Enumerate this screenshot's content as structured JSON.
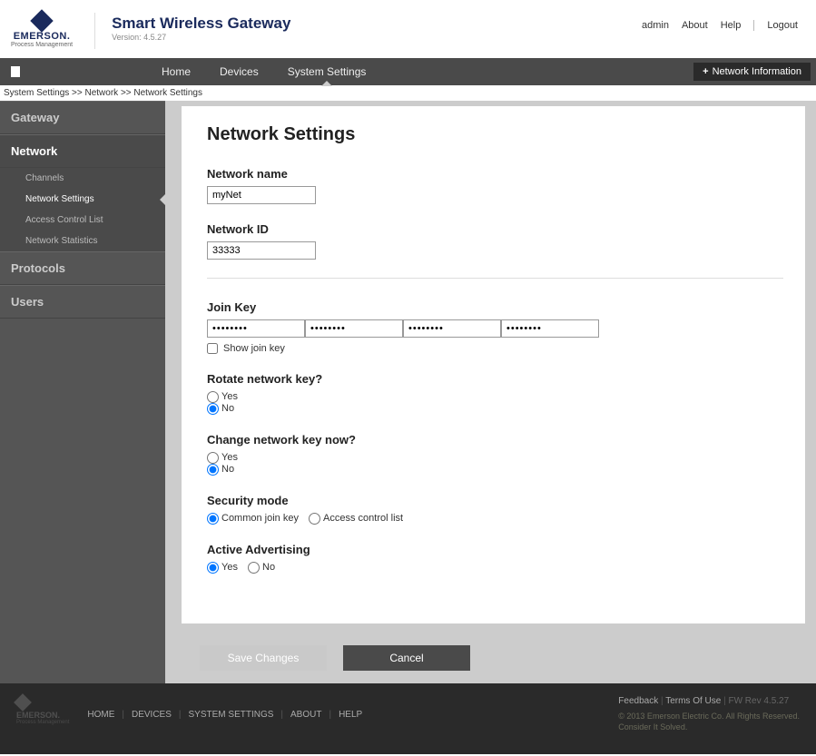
{
  "header": {
    "brand_name": "EMERSON.",
    "brand_sub": "Process Management",
    "app_title": "Smart Wireless Gateway",
    "version": "Version: 4.5.27",
    "links": {
      "admin": "admin",
      "about": "About",
      "help": "Help",
      "logout": "Logout"
    }
  },
  "navbar": {
    "home": "Home",
    "devices": "Devices",
    "system_settings": "System Settings",
    "network_info": "Network Information"
  },
  "breadcrumb": "System Settings >> Network >> Network Settings",
  "sidebar": {
    "gateway": "Gateway",
    "network": "Network",
    "sub": {
      "channels": "Channels",
      "network_settings": "Network Settings",
      "acl": "Access Control List",
      "stats": "Network Statistics"
    },
    "protocols": "Protocols",
    "users": "Users"
  },
  "page": {
    "title": "Network Settings",
    "network_name_label": "Network name",
    "network_name_value": "myNet",
    "network_id_label": "Network ID",
    "network_id_value": "33333",
    "join_key_label": "Join Key",
    "join_key_segments": [
      "••••••••",
      "••••••••",
      "••••••••",
      "••••••••"
    ],
    "show_join_key": "Show join key",
    "rotate_label": "Rotate network key?",
    "change_now_label": "Change network key now?",
    "security_label": "Security mode",
    "security_options": {
      "common": "Common join key",
      "acl": "Access control list"
    },
    "advertising_label": "Active Advertising",
    "yes": "Yes",
    "no": "No",
    "save": "Save Changes",
    "cancel": "Cancel"
  },
  "footer": {
    "links": {
      "home": "HOME",
      "devices": "DEVICES",
      "system": "SYSTEM SETTINGS",
      "about": "ABOUT",
      "help": "HELP"
    },
    "feedback": "Feedback",
    "terms": "Terms Of Use",
    "fwrev": "FW Rev 4.5.27",
    "copyright": "© 2013 Emerson Electric Co. All Rights Reserved.",
    "tagline": "Consider It Solved."
  }
}
